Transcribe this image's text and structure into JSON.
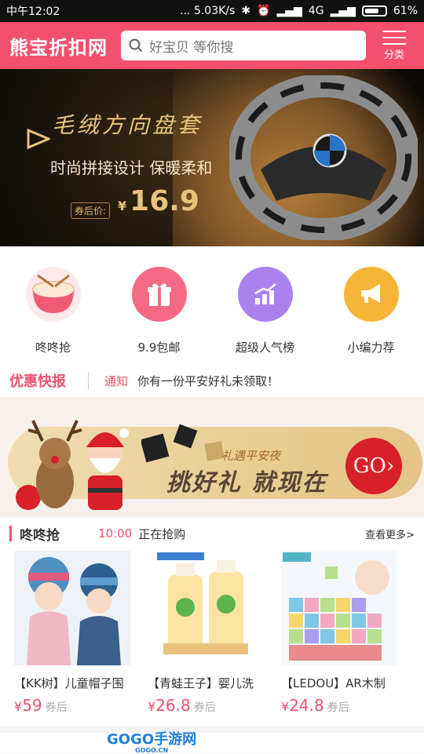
{
  "status_bar": {
    "time": "中午12:02",
    "speed": "... 5.03K/s",
    "network": "4G",
    "battery": "61%"
  },
  "header": {
    "logo": "熊宝折扣网",
    "search_placeholder": "好宝贝 等你搜",
    "category_label": "分类"
  },
  "banner": {
    "title": "毛绒方向盘套",
    "subtitle": "时尚拼接设计 保暖柔和",
    "price_tag": "券后价:",
    "currency": "¥",
    "price": "16.9"
  },
  "quick_links": [
    {
      "label": "咚咚抢",
      "color": "#f9c6cc",
      "icon": "drum-icon"
    },
    {
      "label": "9.9包邮",
      "color": "#f46a84",
      "icon": "gift-icon"
    },
    {
      "label": "超级人气榜",
      "color": "#a982ee",
      "icon": "chart-icon"
    },
    {
      "label": "小编力荐",
      "color": "#f7b537",
      "icon": "megaphone-icon"
    }
  ],
  "news": {
    "title": "优惠快报",
    "tag": "通知",
    "message": "你有一份平安好礼未领取！"
  },
  "promo": {
    "subtitle": "礼遇平安夜",
    "main": "挑好礼 就现在",
    "button": "GO›"
  },
  "flash_sale": {
    "title": "咚咚抢",
    "time": "10:00",
    "status": "正在抢购",
    "more": "查看更多>",
    "products": [
      {
        "name": "【KK树】儿童帽子围",
        "currency": "¥",
        "price": "59",
        "after": "券后"
      },
      {
        "name": "【青蛙王子】婴儿洗",
        "currency": "¥",
        "price": "26.8",
        "after": "券后"
      },
      {
        "name": "【LEDOU】AR木制",
        "currency": "¥",
        "price": "24.8",
        "after": "券后"
      }
    ]
  },
  "watermark": {
    "text": "GOGO手游网",
    "url": "GOGO.CN"
  }
}
